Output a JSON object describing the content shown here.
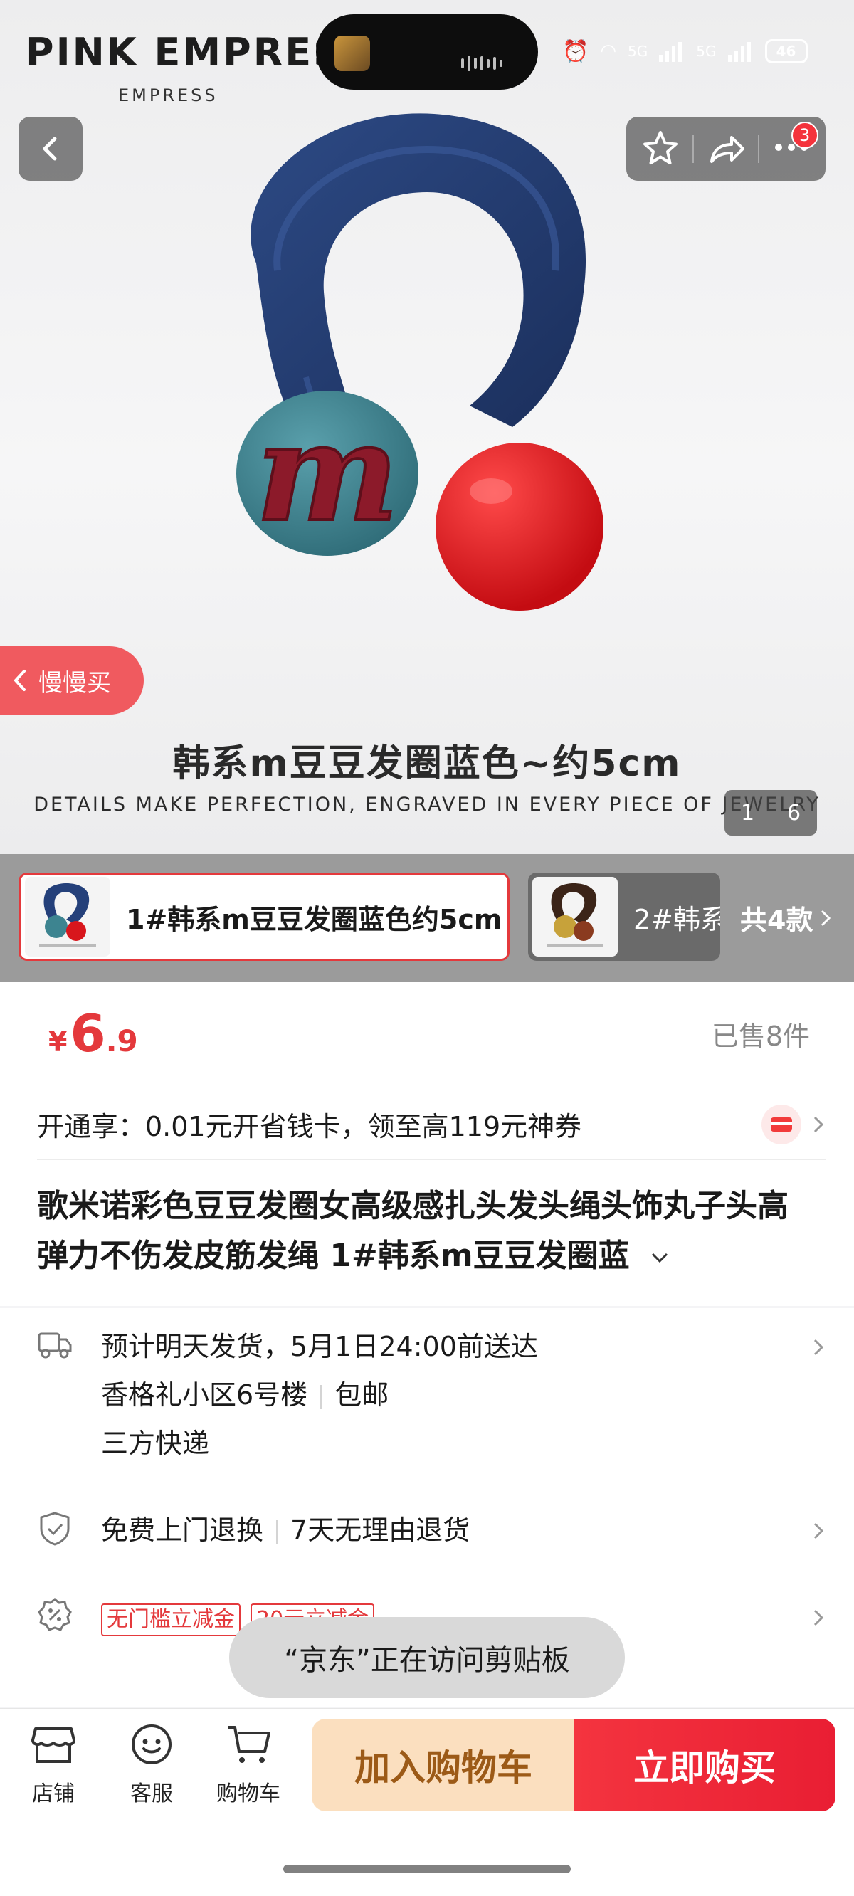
{
  "status_bar": {
    "battery": "46",
    "network1": "5G",
    "network2": "5G"
  },
  "hero": {
    "brand": "PINK EMPRESS",
    "brand_sub": "EMPRESS",
    "cart_badge": "3",
    "slow_buy": "慢慢买",
    "caption": "韩系m豆豆发圈蓝色~约5cm",
    "tagline": "DETAILS MAKE PERFECTION, ENGRAVED IN EVERY PIECE OF JEWELRY",
    "page_current": "1",
    "page_total": "6"
  },
  "variants": {
    "selected_label": "1#韩系m豆豆发圈蓝色约5cm",
    "other_label": "2#韩系",
    "count_label": "共4款"
  },
  "price": {
    "currency": "¥",
    "integer": "6",
    "decimal": ".9",
    "sold": "已售8件"
  },
  "promo": {
    "text": "开通享：0.01元开省钱卡，领至高119元神券"
  },
  "product": {
    "title": "歌米诺彩色豆豆发圈女高级感扎头发头绳头饰丸子头高弹力不伤发皮筋发绳 1#韩系m豆豆发圈蓝"
  },
  "shipping": {
    "line1": "预计明天发货，5月1日24:00前送达",
    "address": "香格礼小区6号楼",
    "free_shipping": "包邮",
    "carrier": "三方快递"
  },
  "returns": {
    "left": "免费上门退换",
    "right": "7天无理由退货"
  },
  "coupons": {
    "tag1": "无门槛立减金",
    "tag2": "20元立减金"
  },
  "toast": {
    "text": "“京东”正在访问剪贴板"
  },
  "bottom_bar": {
    "store": "店铺",
    "service": "客服",
    "cart": "购物车",
    "add_to_cart": "加入购物车",
    "buy_now": "立即购买"
  },
  "colors": {
    "accent_red": "#e4393c",
    "cart_button_bg": "#fbdfbf",
    "buy_button_bg": "#f4343f"
  }
}
